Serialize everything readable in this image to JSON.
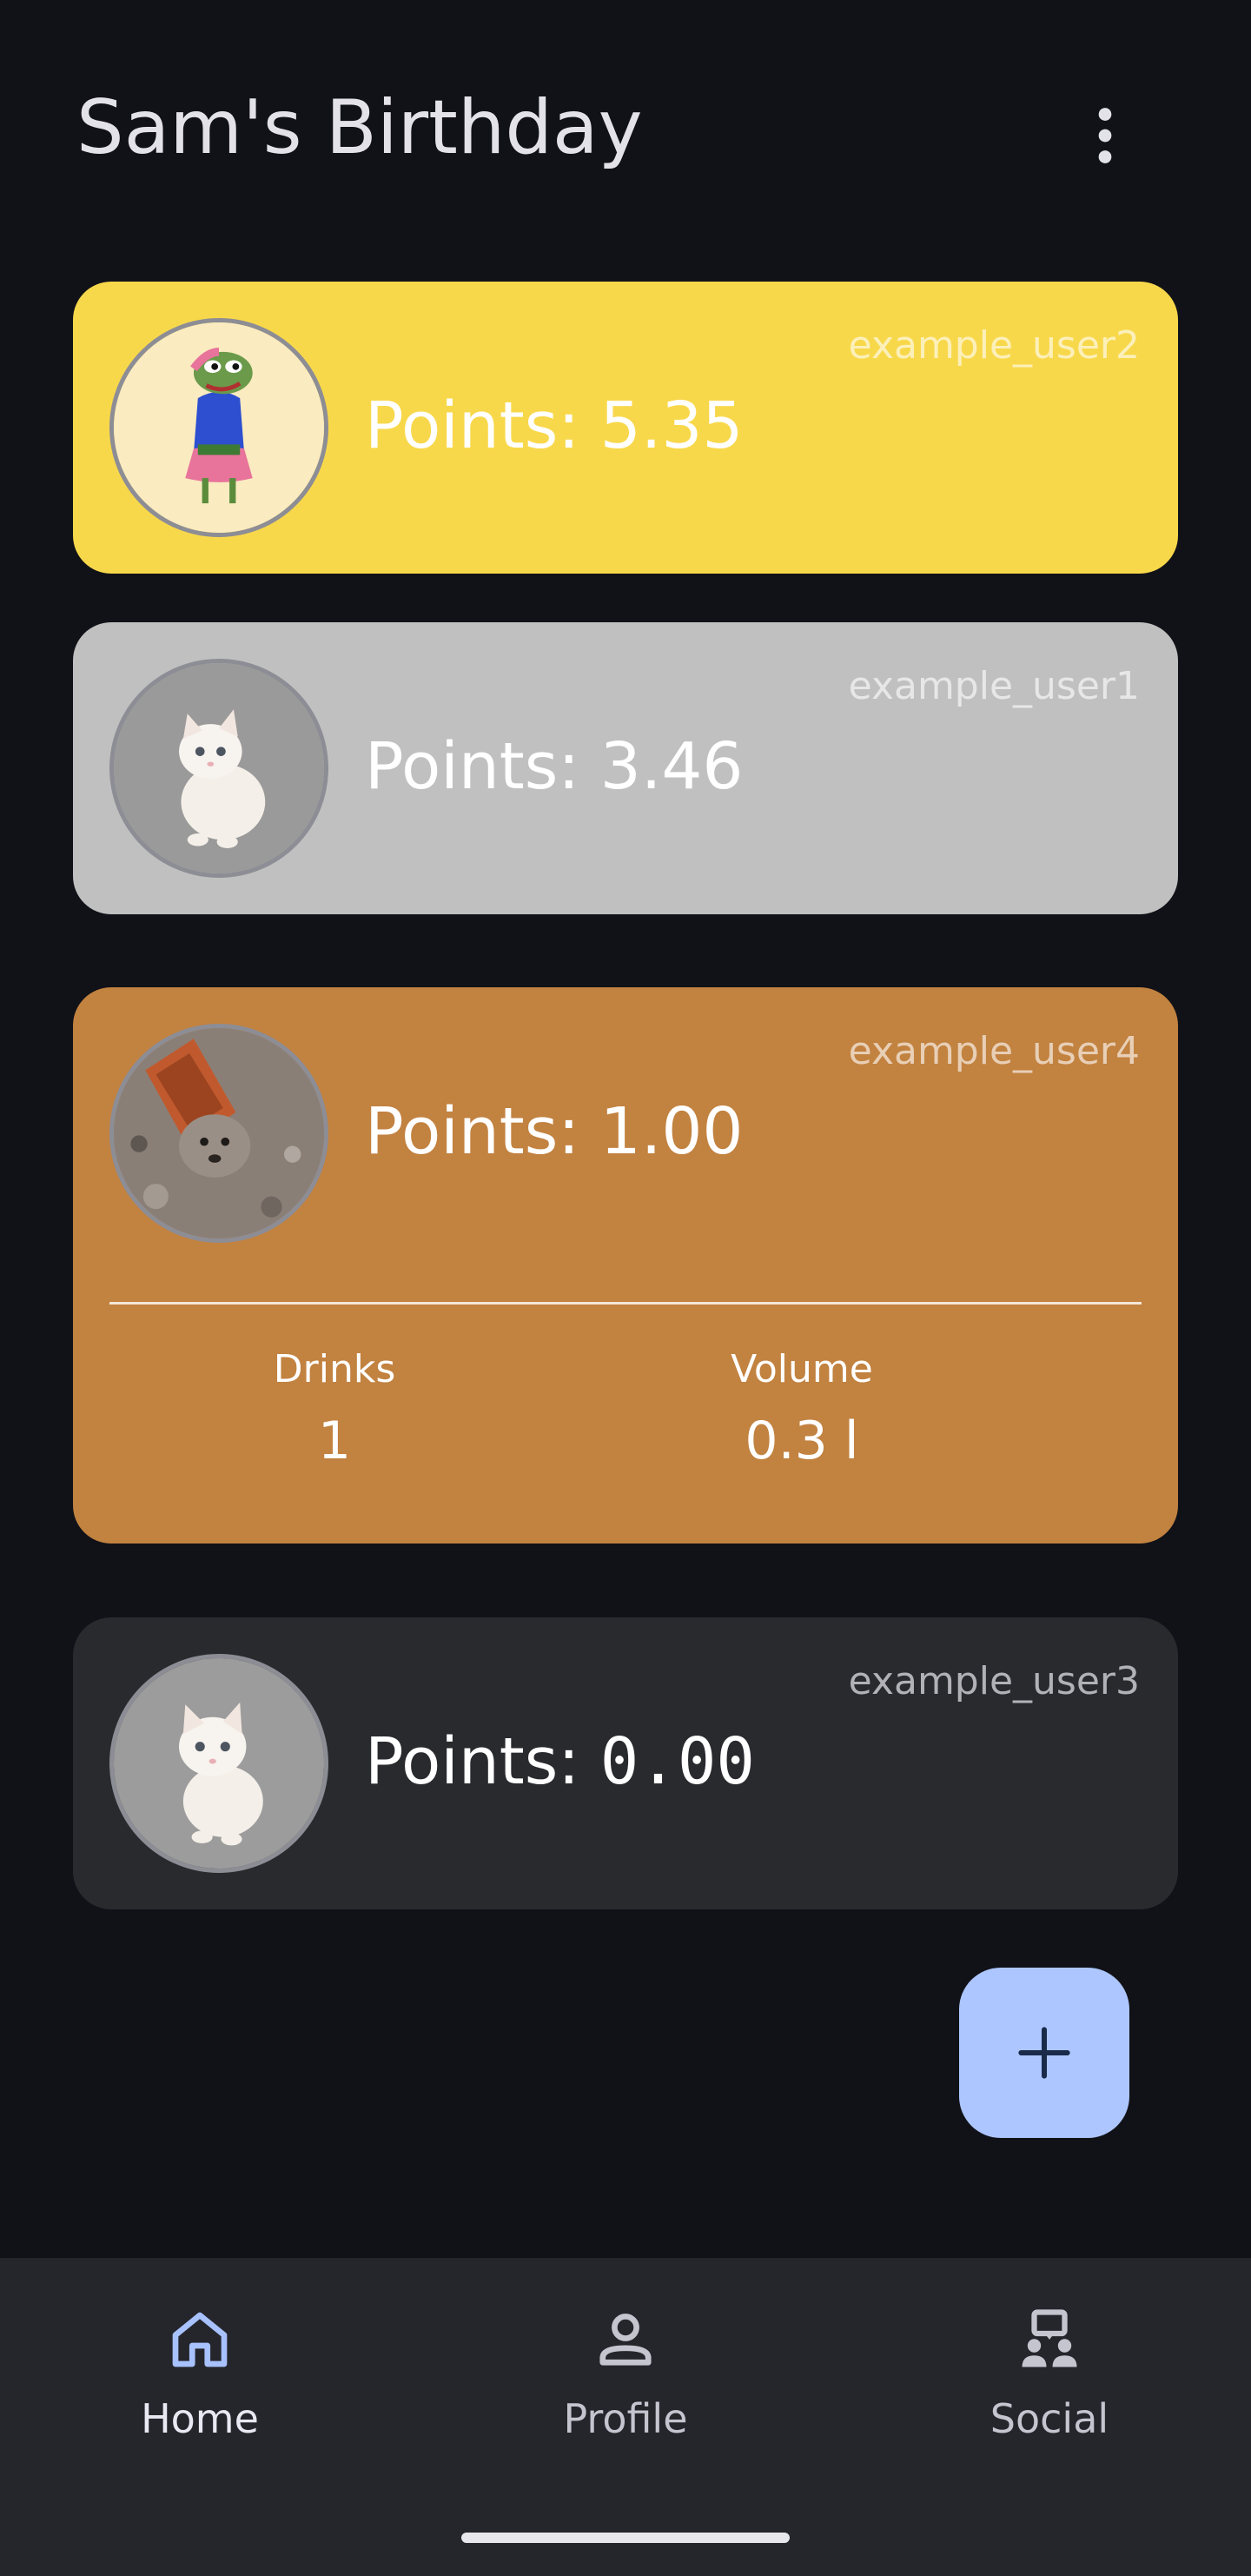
{
  "header": {
    "title": "Sam's Birthday",
    "menu_icon": "more-vert-icon"
  },
  "leaderboard": [
    {
      "rank_color": "#f8d84b",
      "username": "example_user2",
      "points_label": "Points: ",
      "points_value": "5.35",
      "avatar": "frog-character-avatar"
    },
    {
      "rank_color": "#c0c0c0",
      "username": "example_user1",
      "points_label": "Points: ",
      "points_value": "3.46",
      "avatar": "white-kitten-avatar"
    },
    {
      "rank_color": "#c28240",
      "username": "example_user4",
      "points_label": "Points: ",
      "points_value": "1.00",
      "avatar": "seal-in-pipe-avatar",
      "expanded": true,
      "stats": {
        "drinks_label": "Drinks",
        "drinks_value": "1",
        "volume_label": "Volume",
        "volume_value": "0.3 l"
      }
    },
    {
      "rank_color": "#292a2e",
      "username": "example_user3",
      "points_label": "Points: ",
      "points_value": "0.00",
      "avatar": "white-kitten-avatar"
    }
  ],
  "fab": {
    "icon": "add-icon",
    "color": "#adc6ff"
  },
  "bottom_nav": {
    "items": [
      {
        "label": "Home",
        "icon": "home-icon",
        "selected": true
      },
      {
        "label": "Profile",
        "icon": "person-icon",
        "selected": false
      },
      {
        "label": "Social",
        "icon": "social-icon",
        "selected": false
      }
    ]
  }
}
